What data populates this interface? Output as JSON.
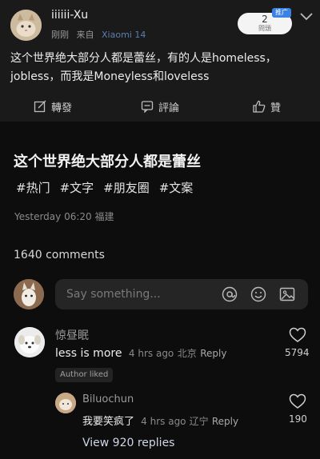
{
  "post": {
    "username": "iiiiii-Xu",
    "time": "刚刚",
    "source_prefix": "来自",
    "device": "Xiaomi 14",
    "follow_count": "2",
    "follow_sub": "問頭",
    "promo_badge": "推广",
    "text": "这个世界绝大部分人都是蕾丝，有的人是homeless，jobless，而我是Moneyless和loveless",
    "actions": {
      "share": "轉發",
      "comment": "評論",
      "like": "贊"
    }
  },
  "topic": {
    "title": "这个世界绝大部分人都是蕾丝",
    "hashtags": [
      "#热门",
      "#文字",
      "#朋友圈",
      "#文案"
    ],
    "time": "Yesterday 06:20 福建"
  },
  "comments_header": "1640 comments",
  "comment_input": {
    "placeholder": "Say something..."
  },
  "comments": [
    {
      "name": "惊昼眠",
      "text": "less is more",
      "time": "4 hrs ago",
      "location": "北京",
      "reply_label": "Reply",
      "likes": "5794",
      "badge": "Author liked"
    }
  ],
  "reply": {
    "name": "Biluochun",
    "text": "我要笑疯了",
    "time": "4 hrs ago",
    "location": "辽宁",
    "reply_label": "Reply",
    "likes": "190"
  },
  "view_replies": "View 920 replies",
  "colors": {
    "background": "#0d0d0d",
    "card": "#1a1a1a",
    "badge": "#3b82e6",
    "link": "#5b7fb0"
  }
}
